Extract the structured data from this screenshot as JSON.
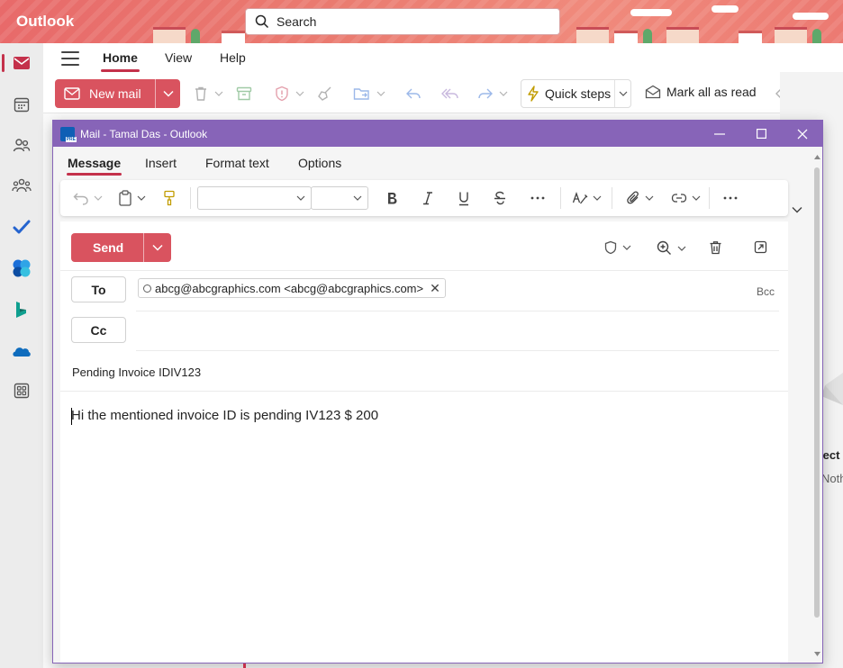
{
  "app": {
    "brand": "Outlook"
  },
  "search": {
    "placeholder": "Search"
  },
  "nav_tabs": [
    {
      "label": "Home",
      "active": true
    },
    {
      "label": "View",
      "active": false
    },
    {
      "label": "Help",
      "active": false
    }
  ],
  "ribbon": {
    "new_mail_label": "New mail",
    "quick_steps_label": "Quick steps",
    "mark_all_read_label": "Mark all as read"
  },
  "rail": [
    {
      "icon": "mail-icon",
      "active": true
    },
    {
      "icon": "calendar-icon",
      "active": false
    },
    {
      "icon": "people-icon",
      "active": false
    },
    {
      "icon": "groups-icon",
      "active": false
    },
    {
      "icon": "todo-icon",
      "active": false
    },
    {
      "icon": "office-icon",
      "active": false
    },
    {
      "icon": "bookings-icon",
      "active": false
    },
    {
      "icon": "onedrive-icon",
      "active": false
    },
    {
      "icon": "more-apps-icon",
      "active": false
    }
  ],
  "compose_window": {
    "title": "Mail - Tamal Das - Outlook",
    "tabs": [
      {
        "label": "Message",
        "active": true
      },
      {
        "label": "Insert",
        "active": false
      },
      {
        "label": "Format text",
        "active": false
      },
      {
        "label": "Options",
        "active": false
      }
    ],
    "send_label": "Send",
    "to_label": "To",
    "cc_label": "Cc",
    "bcc_label": "Bcc",
    "recipient": "abcg@abcgraphics.com <abcg@abcgraphics.com>",
    "subject": "Pending Invoice IDIV123",
    "body": "Hi the mentioned invoice ID is pending IV123 $ 200"
  },
  "reading_pane": {
    "fragment_1": "lect",
    "fragment_2": "Noth"
  },
  "colors": {
    "accent": "#c4314b",
    "button": "#d9535f",
    "window_frame": "#8764b8",
    "header": "#e86a6a"
  }
}
